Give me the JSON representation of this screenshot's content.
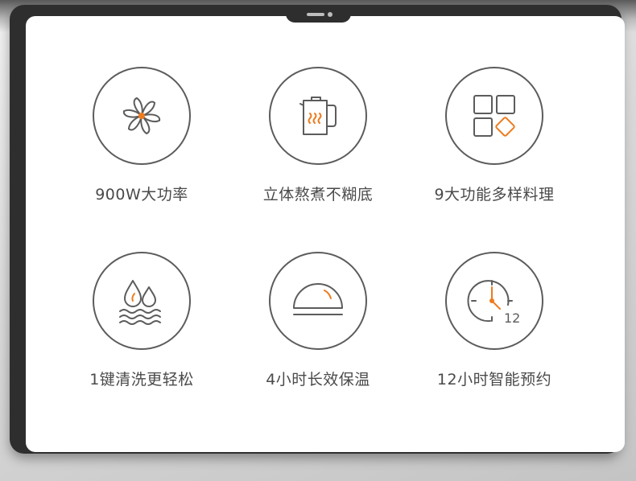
{
  "colors": {
    "accent": "#ee7b1e",
    "icon_stroke": "#5c5c5c",
    "text": "#4a4a4a",
    "frame": "#2e2e2e"
  },
  "features": [
    {
      "label": "900W大功率",
      "icon": "fan-icon"
    },
    {
      "label": "立体熬煮不糊底",
      "icon": "kettle-icon"
    },
    {
      "label": "9大功能多样料理",
      "icon": "grid-function-icon"
    },
    {
      "label": "1键清洗更轻松",
      "icon": "water-drops-icon"
    },
    {
      "label": "4小时长效保温",
      "icon": "dome-warm-icon"
    },
    {
      "label": "12小时智能预约",
      "icon": "clock-icon"
    }
  ],
  "clock_text": "12"
}
